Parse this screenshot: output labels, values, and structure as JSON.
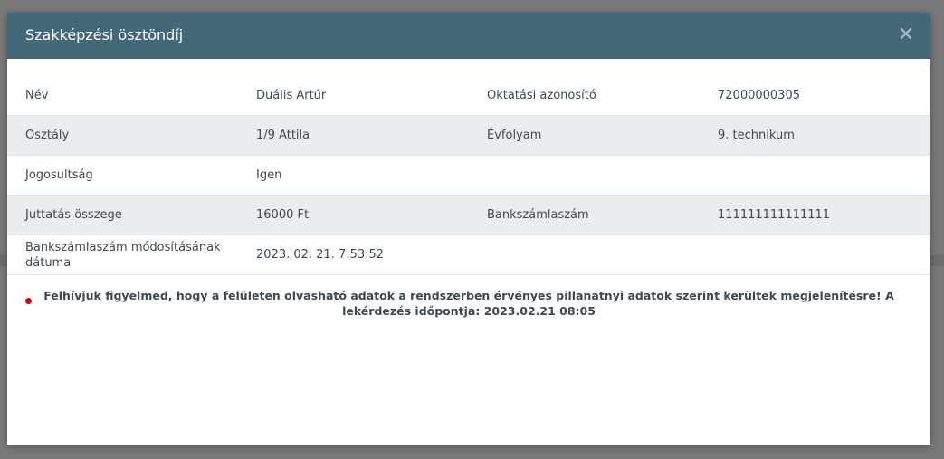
{
  "modal": {
    "title": "Szakképzési ösztöndíj",
    "close_glyph": "✕"
  },
  "rows": [
    {
      "label1": "Név",
      "value1": "Duális Artúr",
      "label2": "Oktatási azonosító",
      "value2": "72000000305"
    },
    {
      "label1": "Osztály",
      "value1": "1/9 Attila",
      "label2": "Évfolyam",
      "value2": "9. technikum"
    },
    {
      "label1": "Jogosultság",
      "value1": "Igen",
      "label2": "",
      "value2": ""
    },
    {
      "label1": "Juttatás összege",
      "value1": "16000 Ft",
      "label2": "Bankszámlaszám",
      "value2": "111111111111111"
    },
    {
      "label1": "Bankszámlaszám módosításának dátuma",
      "value1": "2023. 02. 21. 7:53:52",
      "label2": "",
      "value2": ""
    }
  ],
  "notice": {
    "text": "Felhívjuk figyelmed, hogy a felületen olvasható adatok a rendszerben érvényes pillanatnyi adatok szerint kerültek megjelenítésre! A lekérdezés időpontja: 2023.02.21 08:05"
  },
  "colors": {
    "header_bg": "#426879",
    "stripe_bg": "#e9edf0",
    "notice_dot": "#e00000"
  }
}
